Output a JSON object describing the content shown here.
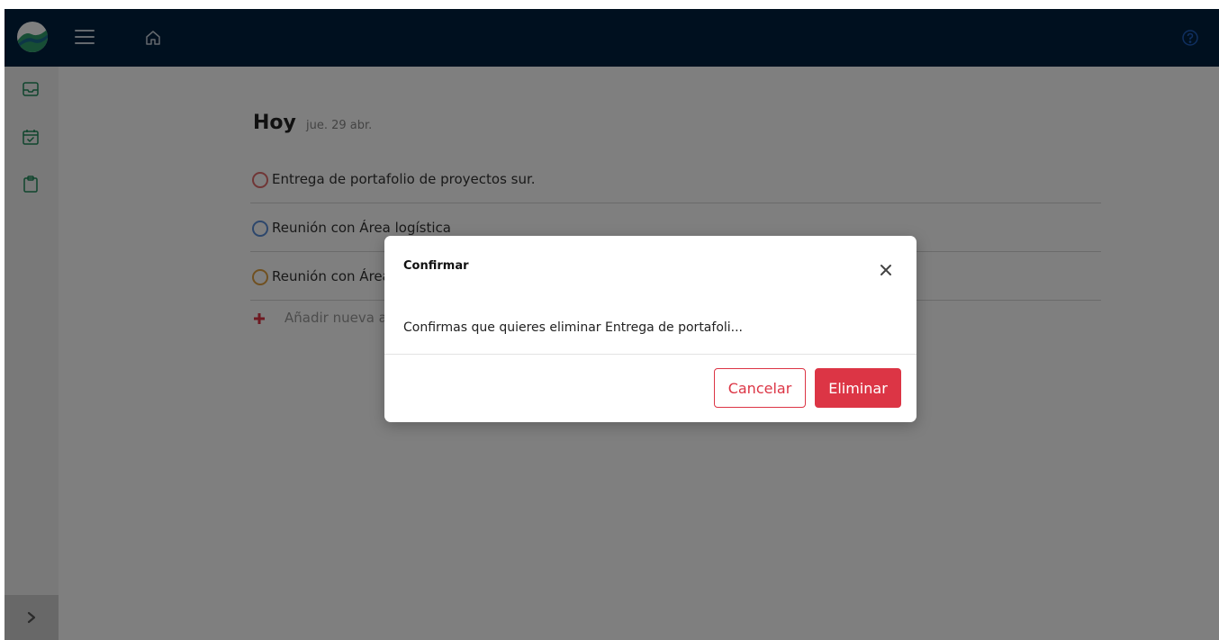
{
  "header": {
    "logo_icon": "app-logo",
    "menu_icon": "hamburger-icon",
    "home_icon": "home-icon",
    "help_icon": "help-icon",
    "bg_color": "#00203f"
  },
  "sidebar": {
    "items": [
      {
        "icon": "inbox-icon"
      },
      {
        "icon": "calendar-check-icon"
      },
      {
        "icon": "clipboard-icon"
      }
    ],
    "collapse_icon": "chevron-right-icon"
  },
  "main": {
    "title": "Hoy",
    "date": "jue. 29 abr.",
    "tasks": [
      {
        "label": "Entrega de portafolio de proyectos sur.",
        "color": "#e06c6c"
      },
      {
        "label": "Reunión con Área logística",
        "color": "#5b8fd9"
      },
      {
        "label": "Reunión con Área",
        "color": "#e0a040"
      }
    ],
    "add_label": "Añadir nueva a",
    "accent_color": "#dc3545"
  },
  "modal": {
    "title": "Confirmar",
    "message": "Confirmas que quieres eliminar Entrega de portafoli...",
    "cancel_label": "Cancelar",
    "delete_label": "Eliminar",
    "danger_color": "#dc3545"
  }
}
